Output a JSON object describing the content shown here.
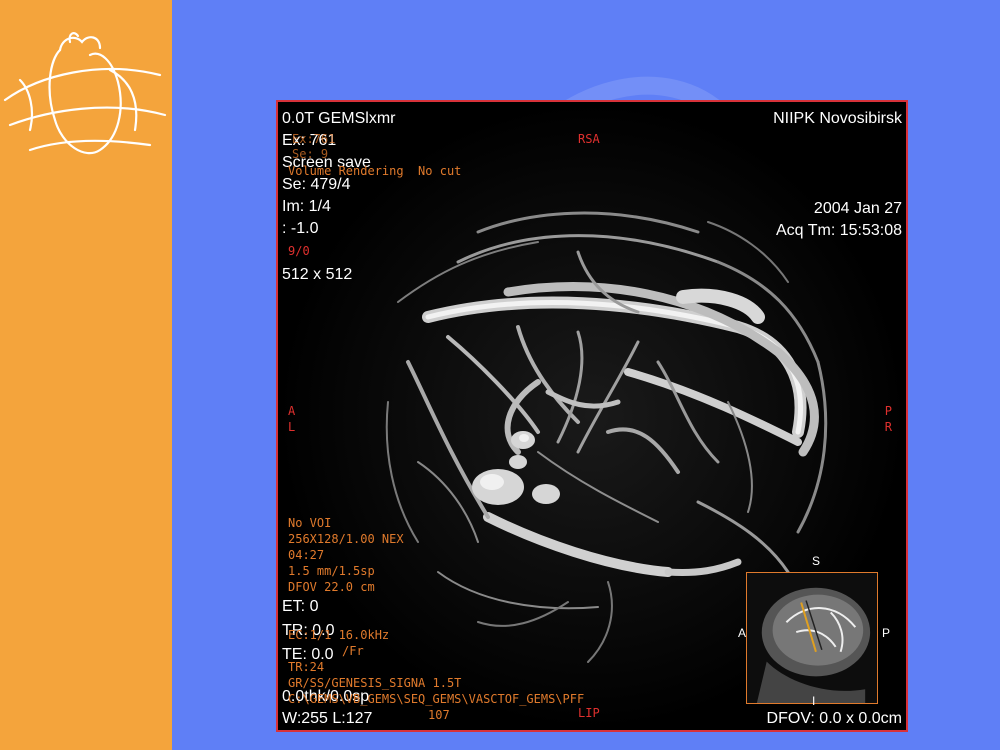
{
  "overlay_white": {
    "scanner": "0.0T GEMSlxmr",
    "exam": "Ex: 761",
    "screen_save": "Screen save",
    "series": "Se: 479/4",
    "image": "Im: 1/4",
    "offset": ": -1.0",
    "matrix": "512 x 512",
    "institution": "NIIPK Novosibirsk",
    "date": "2004 Jan 27",
    "acq_time": "Acq Tm: 15:53:08",
    "et": "ET: 0",
    "tr": "TR: 0.0",
    "te": "TE: 0.0",
    "thickness": "0.0thk/0.0sp",
    "window_level": "W:255 L:127",
    "dfov": "DFOV: 0.0 x 0.0cm"
  },
  "overlay_orange": {
    "ex_faded": "Ex:761",
    "se_faded": "Se: 9",
    "render_mode": "Volume Rendering  No cut",
    "frame": "9/0",
    "voi": "No VOI",
    "acq_matrix": "256X128/1.00 NEX",
    "scan_time": "04:27",
    "slice": "1.5 mm/1.5sp",
    "dfov_cm": "DFOV 22.0 cm",
    "bandwidth": "EC:1/1 16.0kHz",
    "fr": "/Fr",
    "tr_val": "TR:24",
    "sequence": "GR/SS/GENESIS_SIGNA 1.5T",
    "path": "C:\\GEMS\\VB_GEMS\\SEQ_GEMS\\VASCTOF_GEMS\\PFF",
    "w_val": "107"
  },
  "orientation": {
    "top": "RSA",
    "bottom": "LIP",
    "left_1": "A",
    "left_2": "L",
    "right_1": "P",
    "right_2": "R"
  },
  "scout": {
    "top": "S",
    "bottom": "I",
    "left": "A",
    "right": "P"
  },
  "colors": {
    "sidebar": "#f4a43c",
    "background": "#5f7ff6",
    "viewer_border": "#d8323a",
    "overlay_orange": "#e07a2c",
    "overlay_red": "#e0302e"
  }
}
